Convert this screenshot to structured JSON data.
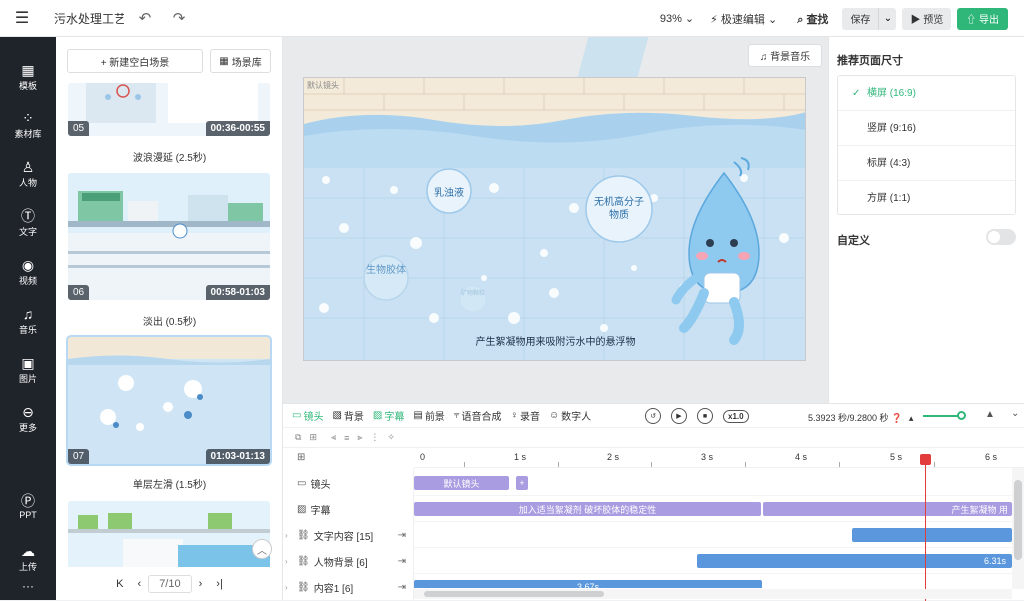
{
  "topbar": {
    "project_title": "污水处理工艺...",
    "zoom": "93% ⌄",
    "fast_edit": "⚡ 极速编辑 ⌄",
    "find": "查找",
    "save": "保存",
    "save_dropdown": "⌄",
    "preview": "▶ 预览",
    "export": "导出"
  },
  "leftnav": {
    "items": [
      {
        "label": "模板",
        "icon": "template-icon"
      },
      {
        "label": "素材库",
        "icon": "material-icon"
      },
      {
        "label": "人物",
        "icon": "person-icon"
      },
      {
        "label": "文字",
        "icon": "text-icon"
      },
      {
        "label": "视频",
        "icon": "video-icon"
      },
      {
        "label": "音乐",
        "icon": "music-icon"
      },
      {
        "label": "图片",
        "icon": "image-icon"
      },
      {
        "label": "更多",
        "icon": "more-icon"
      },
      {
        "label": "PPT",
        "icon": "ppt-icon"
      },
      {
        "label": "上传",
        "icon": "upload-icon"
      }
    ]
  },
  "scenes": {
    "new_blank": "+ 新建空白场景",
    "library": "场景库",
    "items": [
      {
        "num": "05",
        "duration": "00:36-00:55",
        "transition": "波浪漫延 (2.5秒)"
      },
      {
        "num": "06",
        "duration": "00:58-01:03",
        "transition": "淡出 (0.5秒)"
      },
      {
        "num": "07",
        "duration": "01:03-01:13",
        "transition": "单层左滑 (1.5秒)"
      }
    ],
    "pager": {
      "first": "K",
      "prev": "‹",
      "current": "7/10",
      "next": "›",
      "last": "›|"
    }
  },
  "canvas": {
    "bgm_button": "♫ 背景音乐",
    "default_camera": "默认镜头",
    "bubble_1": "乳浊液",
    "bubble_2": "无机高分子物质",
    "bubble_3": "生物胶体",
    "bubble_4": "矿物颗粒",
    "caption": "产生絮凝物用来吸附污水中的悬浮物"
  },
  "right_panel": {
    "title": "推荐页面尺寸",
    "sizes": [
      {
        "label": "横屏 (16:9)",
        "active": true
      },
      {
        "label": "竖屏 (9:16)",
        "active": false
      },
      {
        "label": "标屏 (4:3)",
        "active": false
      },
      {
        "label": "方屏 (1:1)",
        "active": false
      }
    ],
    "custom": "自定义"
  },
  "timeline": {
    "tools": [
      {
        "label": "镜头",
        "icon": "camera-icon",
        "on": true
      },
      {
        "label": "背景",
        "icon": "background-icon",
        "on": false
      },
      {
        "label": "字幕",
        "icon": "subtitle-icon",
        "on": true
      },
      {
        "label": "前景",
        "icon": "foreground-icon",
        "on": false
      },
      {
        "label": "语音合成",
        "icon": "tts-icon",
        "on": false
      },
      {
        "label": "录音",
        "icon": "mic-icon",
        "on": false
      },
      {
        "label": "数字人",
        "icon": "digital-human-icon",
        "on": false
      }
    ],
    "speed": "x1.0",
    "time_info": "5.3923 秒/9.2800 秒",
    "ruler": [
      "0",
      "1 s",
      "2 s",
      "3 s",
      "4 s",
      "5 s",
      "6 s"
    ],
    "tracks": [
      {
        "label": "镜头",
        "count": ""
      },
      {
        "label": "字幕",
        "count": ""
      },
      {
        "label": "文字内容 [15]",
        "count": ""
      },
      {
        "label": "人物背景 [6]",
        "count": ""
      },
      {
        "label": "内容1 [6]",
        "count": ""
      }
    ],
    "clips": {
      "camera": "默认镜头",
      "camera_add": "+",
      "subtitle_1": "加入适当絮凝剂 破坏胶体的稳定性",
      "subtitle_2": "产生絮凝物 用",
      "person_bg": "6.31s",
      "content1": "3.67s"
    }
  },
  "colors": {
    "accent": "#2fb77a",
    "nav_bg": "#1f232a",
    "clip_purple": "#a99ce0",
    "clip_blue": "#5b97dc",
    "playhead": "#e23c3c"
  }
}
